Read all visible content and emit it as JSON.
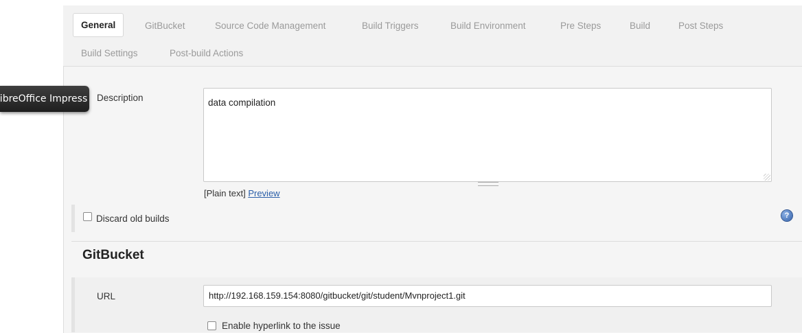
{
  "tabs": [
    {
      "label": "General",
      "active": true
    },
    {
      "label": "GitBucket"
    },
    {
      "label": "Source Code Management"
    },
    {
      "label": "Build Triggers"
    },
    {
      "label": "Build Environment"
    },
    {
      "label": "Pre Steps"
    },
    {
      "label": "Build"
    },
    {
      "label": "Post Steps"
    },
    {
      "label": "Build Settings"
    },
    {
      "label": "Post-build Actions"
    }
  ],
  "tooltip": {
    "text": "LibreOffice Impress"
  },
  "general": {
    "description_label": "Description",
    "description_value": "data compilation",
    "plain_text": "[Plain text]",
    "preview_link": "Preview",
    "discard_old_builds": "Discard old builds",
    "discard_checked": false,
    "help_icon": "question-circle-icon"
  },
  "gitbucket": {
    "title": "GitBucket",
    "url_label": "URL",
    "url_value": "http://192.168.159.154:8080/gitbucket/git/student/Mvnproject1.git",
    "enable_hyperlink": "Enable hyperlink to the issue",
    "enable_hyperlink_checked": false
  },
  "colors": {
    "link": "#2a5ea8",
    "panel_bg": "#f5f5f5",
    "tooltip_bg": "#2a2a2a"
  }
}
